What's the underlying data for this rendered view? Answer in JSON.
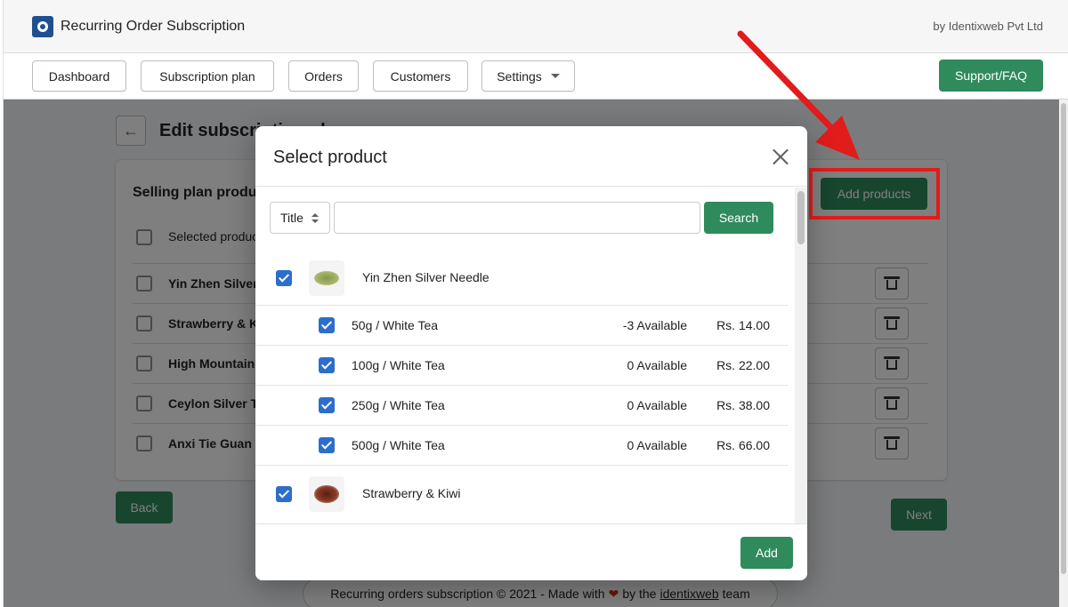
{
  "app": {
    "title": "Recurring Order Subscription",
    "by": "by Identixweb Pvt Ltd"
  },
  "nav": {
    "dashboard": "Dashboard",
    "subscription_plan": "Subscription plan",
    "orders": "Orders",
    "customers": "Customers",
    "settings": "Settings",
    "support": "Support/FAQ"
  },
  "page": {
    "title": "Edit subscription plan",
    "card_title": "Selling plan products",
    "add_products": "Add products",
    "selected_label": "Selected products",
    "products": [
      {
        "name": "Yin Zhen Silver Needle"
      },
      {
        "name": "Strawberry & Kiwi"
      },
      {
        "name": "High Mountain Oolong"
      },
      {
        "name": "Ceylon Silver Tips"
      },
      {
        "name": "Anxi Tie Guan Yin"
      }
    ],
    "back": "Back",
    "next": "Next"
  },
  "footer": {
    "prefix": "Recurring orders subscription © 2021 - Made with",
    "middle": "by the",
    "link": "identixweb",
    "suffix": "team"
  },
  "modal": {
    "title": "Select product",
    "filter": "Title",
    "search_value": "",
    "search_button": "Search",
    "products": [
      {
        "name": "Yin Zhen Silver Needle",
        "variants": [
          {
            "name": "50g / White Tea",
            "available": "-3 Available",
            "price": "Rs. 14.00"
          },
          {
            "name": "100g / White Tea",
            "available": "0 Available",
            "price": "Rs. 22.00"
          },
          {
            "name": "250g / White Tea",
            "available": "0 Available",
            "price": "Rs. 38.00"
          },
          {
            "name": "500g / White Tea",
            "available": "0 Available",
            "price": "Rs. 66.00"
          }
        ]
      },
      {
        "name": "Strawberry & Kiwi",
        "variants": []
      }
    ],
    "add_button": "Add"
  }
}
